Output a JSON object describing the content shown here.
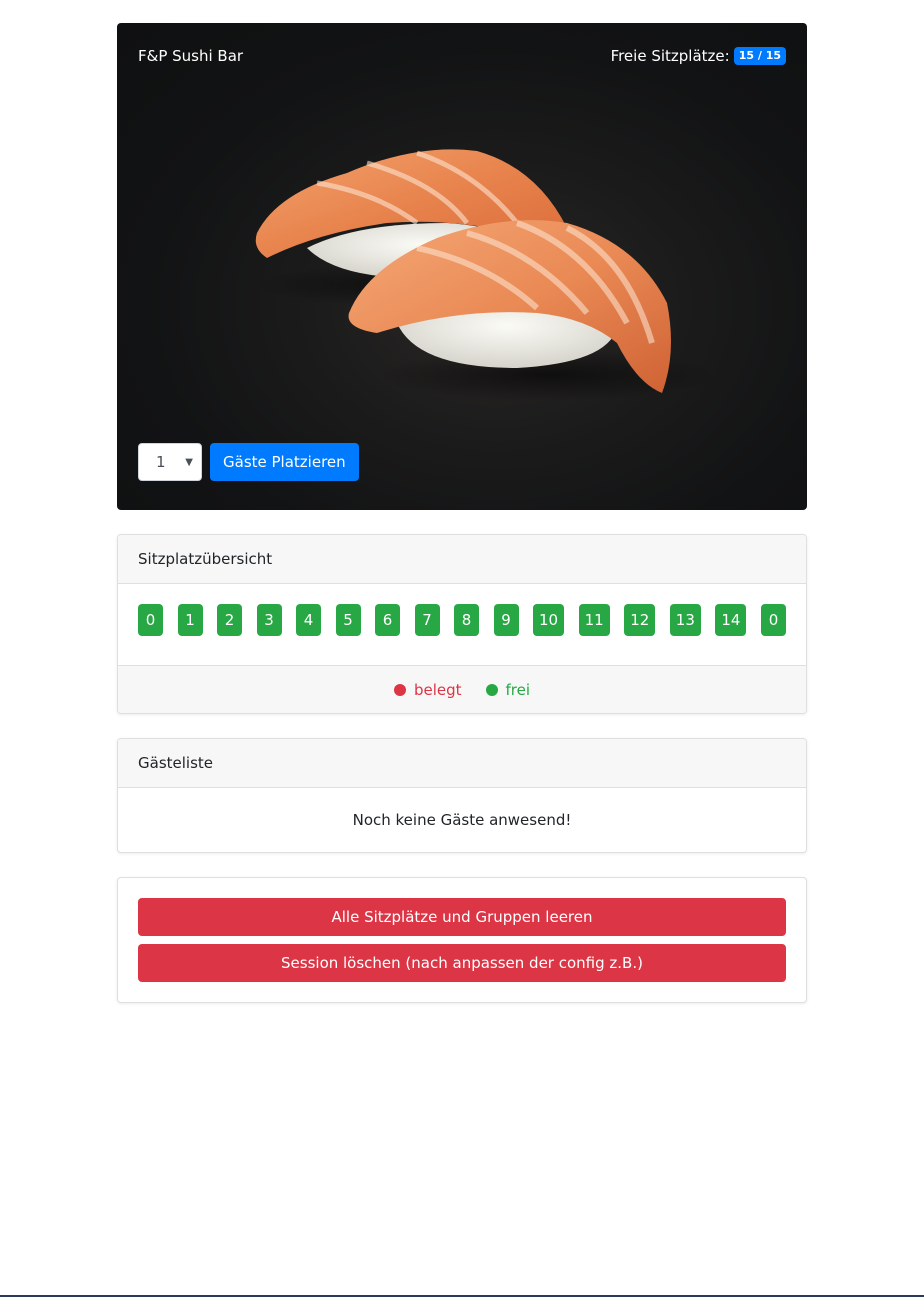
{
  "hero": {
    "title": "F&P Sushi Bar",
    "seats_label": "Freie Sitzplätze:",
    "seats_badge": "15 / 15",
    "select_value": "1",
    "place_button": "Gäste Platzieren"
  },
  "seat_overview": {
    "header": "Sitzplatzübersicht",
    "seats": [
      "0",
      "1",
      "2",
      "3",
      "4",
      "5",
      "6",
      "7",
      "8",
      "9",
      "10",
      "11",
      "12",
      "13",
      "14",
      "0"
    ],
    "legend": {
      "occupied_label": "belegt",
      "free_label": "frei",
      "occupied_color": "#dc3545",
      "free_color": "#28a745"
    }
  },
  "guest_list": {
    "header": "Gästeliste",
    "empty_text": "Noch keine Gäste anwesend!"
  },
  "actions": {
    "clear_button": "Alle Sitzplätze und Gruppen leeren",
    "delete_session_button": "Session löschen (nach anpassen der config z.B.)"
  },
  "colors": {
    "primary": "#007bff",
    "success": "#28a745",
    "danger": "#dc3545"
  }
}
